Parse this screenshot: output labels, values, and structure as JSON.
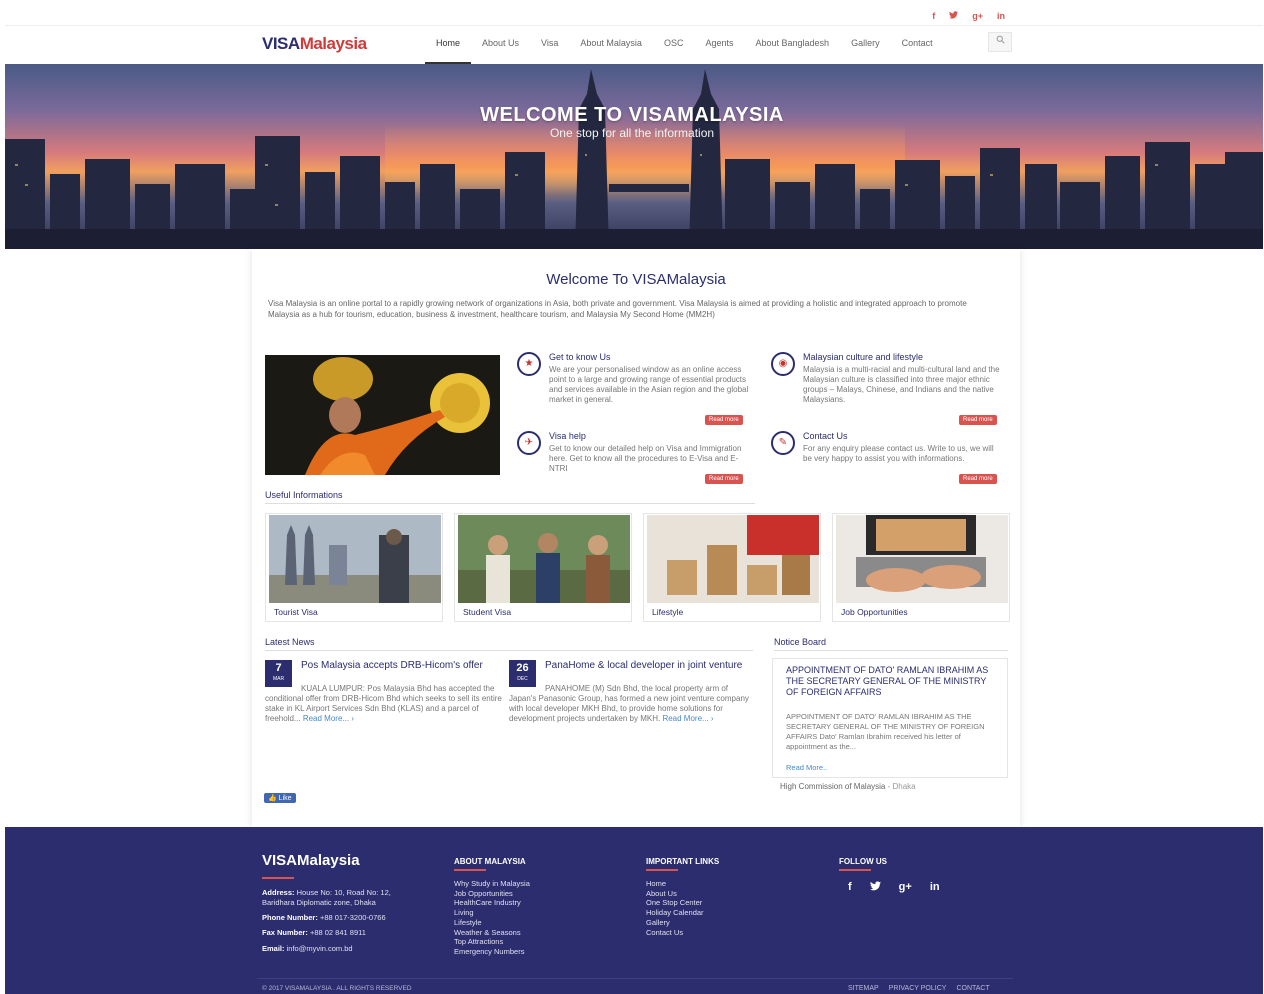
{
  "top_social": [
    "f",
    "t",
    "g+",
    "in"
  ],
  "nav": {
    "logo_part1": "VISA",
    "logo_part2": "Malaysia",
    "items": [
      "Home",
      "About Us",
      "Visa",
      "About Malaysia",
      "OSC",
      "Agents",
      "About Bangladesh",
      "Gallery",
      "Contact"
    ],
    "active": "Home",
    "search_icon": "magnifier"
  },
  "hero": {
    "title": "WELCOME TO VISAMALAYSIA",
    "subtitle": "One stop for all the information"
  },
  "welcome": {
    "heading": "Welcome To VISAMalaysia",
    "intro": "Visa Malaysia is an online portal to a rapidly growing network of organizations in Asia, both private and government. Visa Malaysia is aimed at providing a holistic and integrated approach to promote Malaysia as a hub for tourism, education, business & investment, healthcare tourism, and Malaysia My Second Home (MM2H)"
  },
  "features": [
    {
      "title": "Get to know Us",
      "text": "We are your personalised window as an online access point to a large and growing range of essential products and services available in the Asian region and the global market in general.",
      "button": "Read more",
      "icon": "star"
    },
    {
      "title": "Malaysian culture and lifestyle",
      "text": "Malaysia is a multi-racial and multi-cultural land and the Malaysian culture is classified into three major ethnic groups – Malays, Chinese, and Indians and the native Malaysians.",
      "button": "Read more",
      "icon": "eye"
    },
    {
      "title": "Visa help",
      "text": "Get to know our detailed help on Visa and Immigration here. Get to know all the procedures to E-Visa and E-NTRI",
      "button": "Read more",
      "icon": "plane"
    },
    {
      "title": "Contact Us",
      "text": "For any enquiry please contact us. Write to us, we will be very happy to assist you with informations.",
      "button": "Read more",
      "icon": "pencil"
    }
  ],
  "useful": {
    "title": "Useful Informations",
    "tiles": [
      "Tourist Visa",
      "Student Visa",
      "Lifestyle",
      "Job Opportunities"
    ]
  },
  "news": {
    "title": "Latest News",
    "items": [
      {
        "day": "7",
        "month": "MAR",
        "title": "Pos Malaysia accepts DRB-Hicom's offer",
        "text": "KUALA LUMPUR: Pos Malaysia Bhd has accepted the conditional offer from DRB-Hicom Bhd which seeks to sell its entire stake in KL Airport Services Sdn Bhd (KLAS) and a parcel of freehold...",
        "more": "Read More... ›"
      },
      {
        "day": "26",
        "month": "DEC",
        "title": "PanaHome & local developer in joint venture",
        "text": "PANAHOME (M) Sdn Bhd, the local property arm of Japan's Panasonic Group, has formed a new joint venture company with local developer MKH Bhd, to provide home solutions for development projects undertaken by MKH.",
        "more": "Read More... ›"
      }
    ]
  },
  "notice": {
    "title": "Notice Board",
    "heading": "APPOINTMENT OF DATO' RAMLAN IBRAHIM AS THE SECRETARY GENERAL OF THE MINISTRY OF FOREIGN AFFAIRS",
    "text": "APPOINTMENT OF DATO' RAMLAN IBRAHIM AS THE SECRETARY GENERAL OF THE MINISTRY OF FOREIGN AFFAIRS Dato' Ramlan Ibrahim received his letter of appointment as the...",
    "more": "Read More..",
    "commission": "High Commission of Malaysia",
    "commission_city": "- Dhaka"
  },
  "like_button": "Like",
  "footer": {
    "logo": "VISAMalaysia",
    "address_label": "Address:",
    "address": "House No: 10, Road No: 12, Baridhara Diplomatic zone, Dhaka",
    "phone_label": "Phone Number:",
    "phone": "+88 017-3200-0766",
    "fax_label": "Fax Number:",
    "fax": "+88 02 841 8911",
    "email_label": "Email:",
    "email": "info@myvin.com.bd",
    "about_title": "ABOUT MALAYSIA",
    "about_links": [
      "Why Study in Malaysia",
      "Job Opportunities",
      "HealthCare Industry",
      "Living",
      "Lifestyle",
      "Weather & Seasons",
      "Top Attractions",
      "Emergency Numbers"
    ],
    "links_title": "IMPORTANT LINKS",
    "important_links": [
      "Home",
      "About Us",
      "One Stop Center",
      "Holiday Calendar",
      "Gallery",
      "Contact Us"
    ],
    "follow_title": "FOLLOW US",
    "follow_icons": [
      "f",
      "t",
      "g+",
      "in"
    ],
    "copyright": "© 2017 VISAMALAYSIA . ALL RIGHTS RESERVED",
    "bottom_links": [
      "SITEMAP",
      "PRIVACY POLICY",
      "CONTACT"
    ]
  },
  "colors": {
    "brand_navy": "#2b2d6e",
    "accent_red": "#d9534f"
  }
}
